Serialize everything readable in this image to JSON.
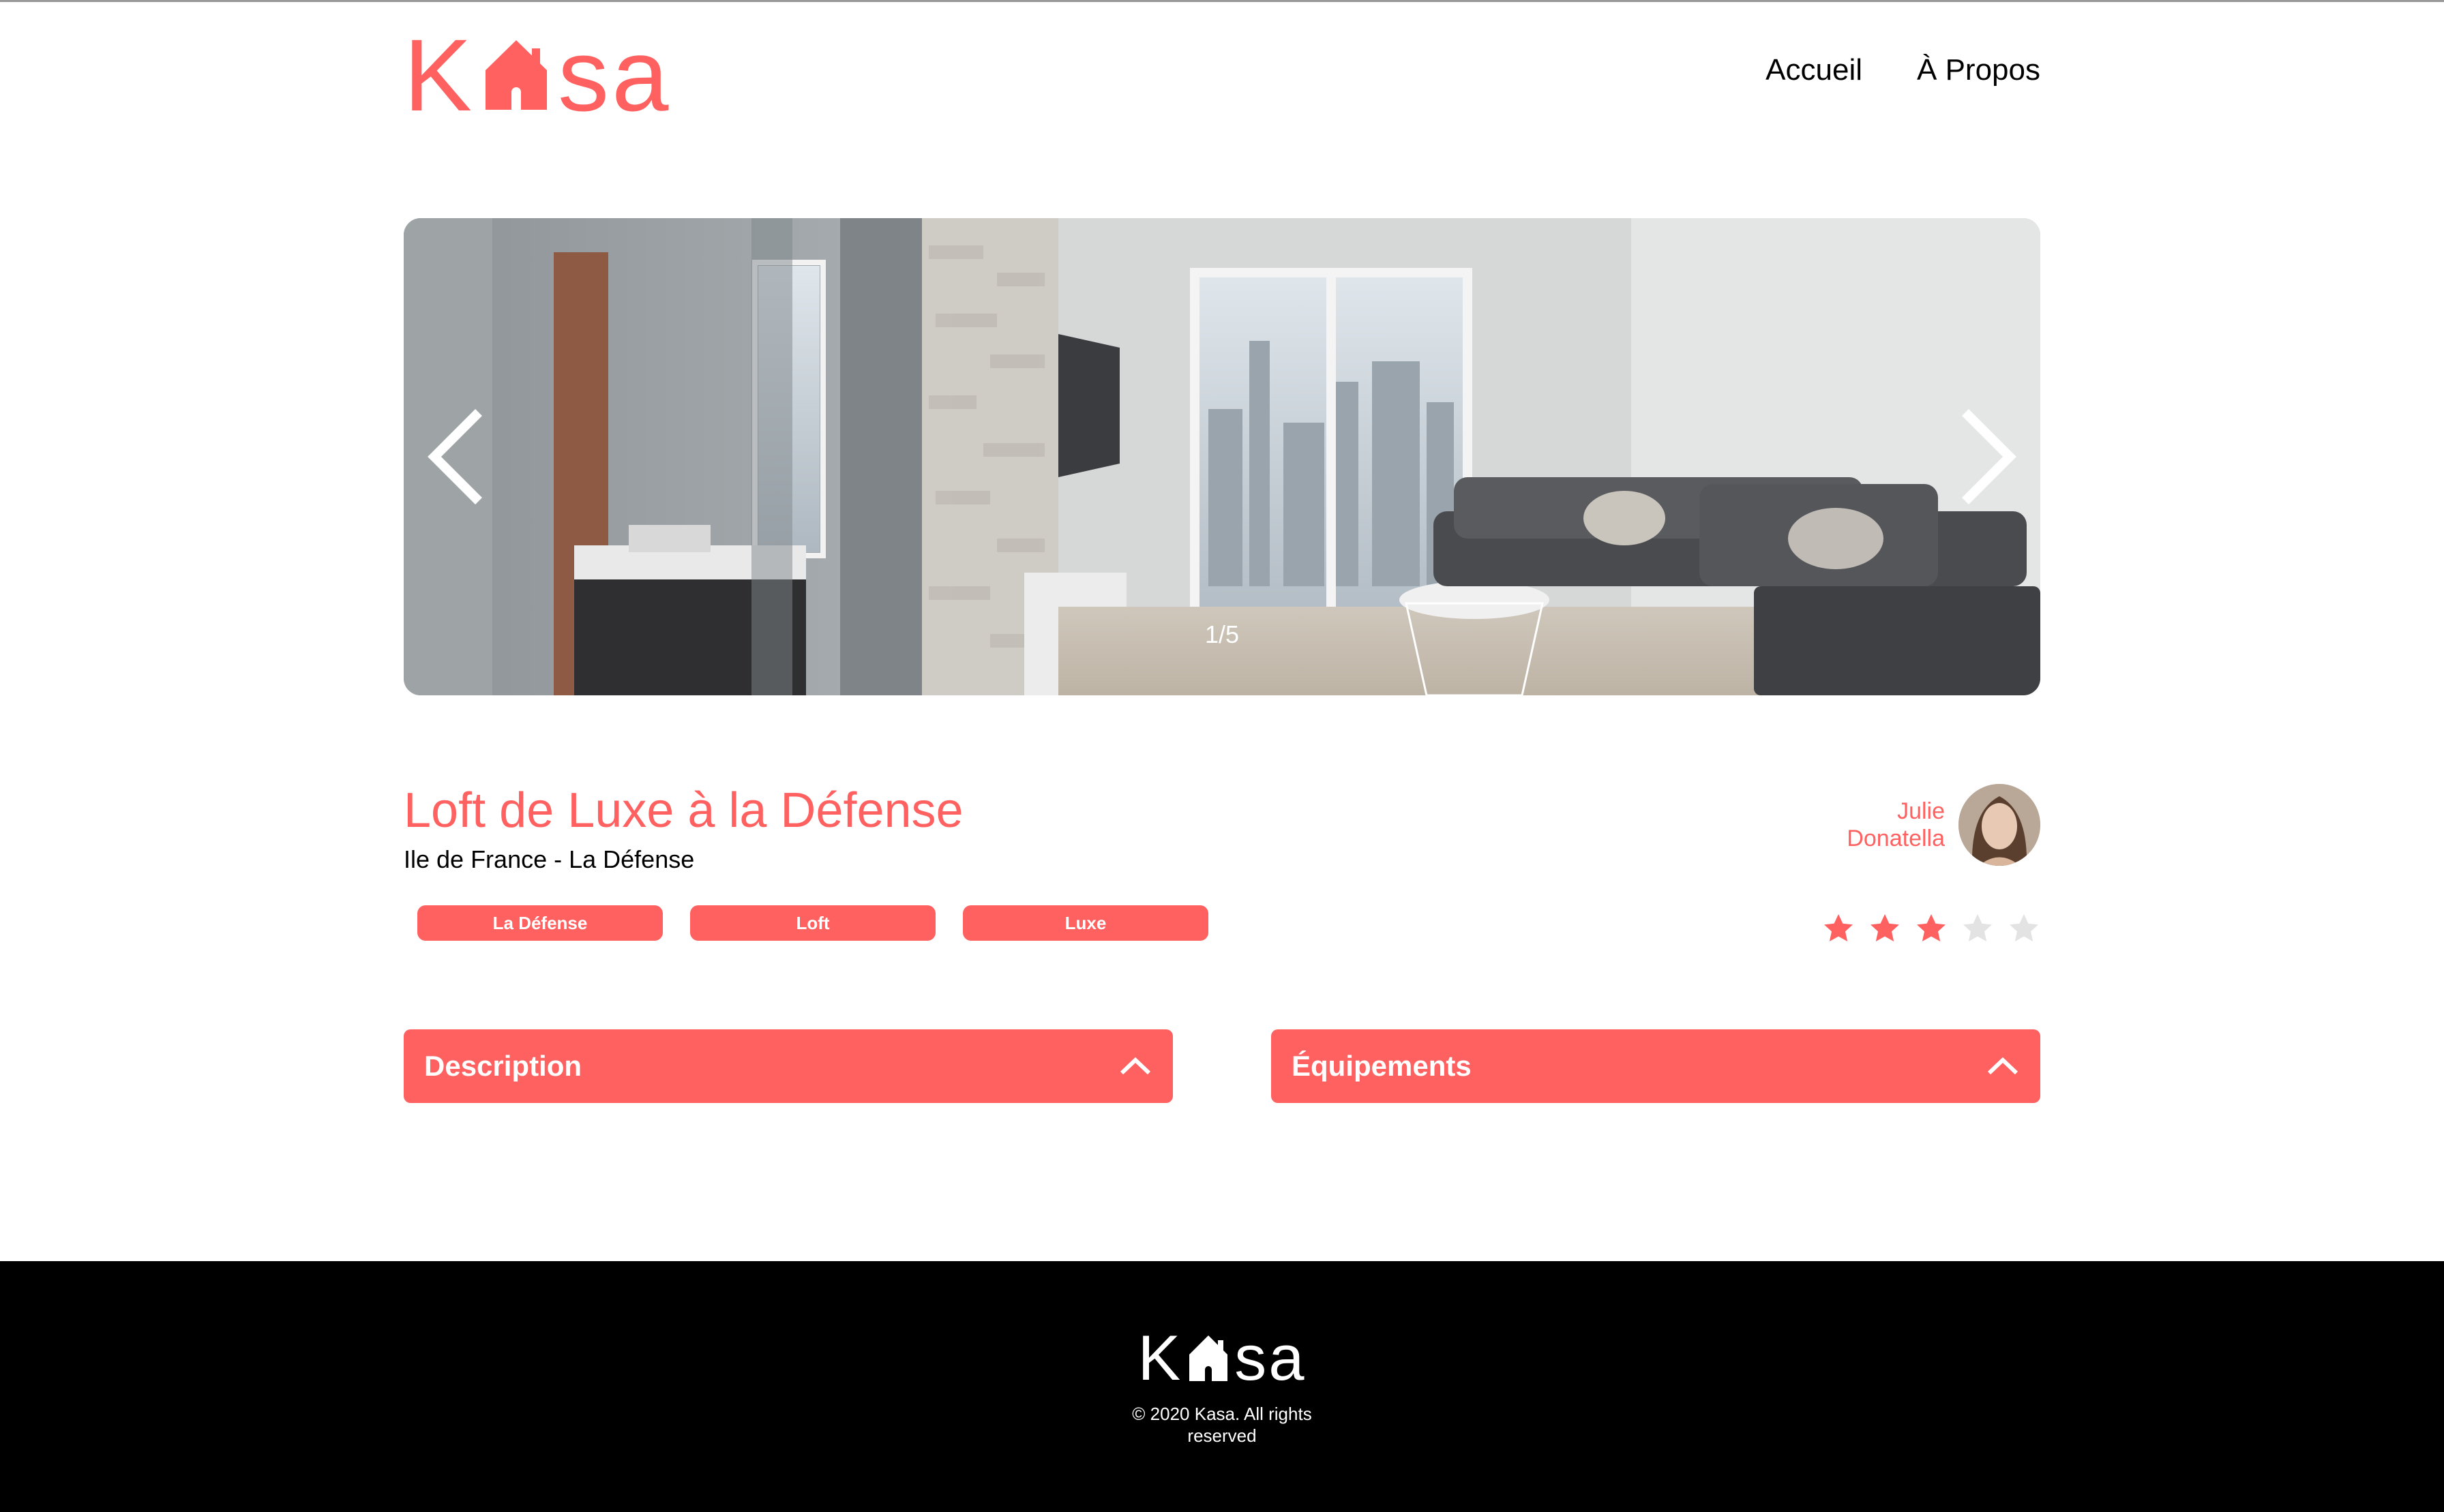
{
  "header": {
    "logo_prefix": "K",
    "logo_suffix": "sa",
    "nav": [
      {
        "label": "Accueil"
      },
      {
        "label": "À Propos"
      }
    ]
  },
  "carousel": {
    "counter": "1/5",
    "current": 1,
    "total": 5
  },
  "listing": {
    "title": "Loft de Luxe à la Défense",
    "location": "Ile de France - La Défense",
    "tags": [
      "La Défense",
      "Loft",
      "Luxe"
    ],
    "host": {
      "first_name": "Julie",
      "last_name": "Donatella"
    },
    "rating": 3,
    "rating_max": 5
  },
  "collapses": {
    "description": "Description",
    "equipment": "Équipements"
  },
  "footer": {
    "logo_prefix": "K",
    "logo_suffix": "sa",
    "copyright": "© 2020 Kasa. All rights reserved"
  },
  "colors": {
    "accent": "#FF6060",
    "star_off": "#E3E3E3",
    "footer_bg": "#000000"
  }
}
